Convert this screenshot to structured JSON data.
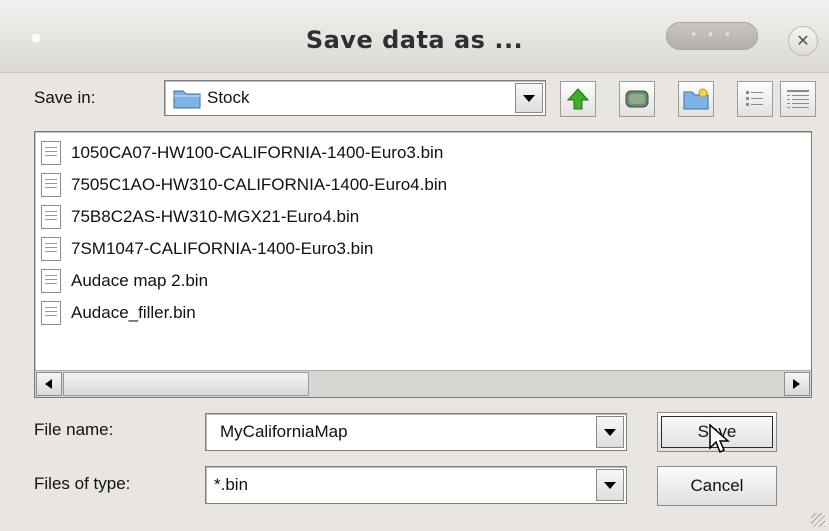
{
  "window": {
    "title": "Save data as ...",
    "title_bar_pill": "• • •",
    "close_glyph": "✕"
  },
  "save_in": {
    "label": "Save in:",
    "folder": "Stock",
    "folder_icon": "folder-icon",
    "toolbar": [
      {
        "name": "up-one-level-button",
        "icon": "green-up-arrow-icon"
      },
      {
        "name": "desktop-button",
        "icon": "desktop-icon"
      },
      {
        "name": "create-new-folder-button",
        "icon": "new-folder-icon"
      },
      {
        "name": "list-view-button",
        "icon": "list-view-icon"
      },
      {
        "name": "details-view-button",
        "icon": "details-view-icon"
      }
    ]
  },
  "files": [
    {
      "name": "1050CA07-HW100-CALIFORNIA-1400-Euro3.bin"
    },
    {
      "name": "7505C1AO-HW310-CALIFORNIA-1400-Euro4.bin"
    },
    {
      "name": "75B8C2AS-HW310-MGX21-Euro4.bin"
    },
    {
      "name": "7SM1047-CALIFORNIA-1400-Euro3.bin"
    },
    {
      "name": "Audace map 2.bin"
    },
    {
      "name": "Audace_filler.bin"
    }
  ],
  "file_name": {
    "label": "File name:",
    "value": "MyCaliforniaMap"
  },
  "file_type": {
    "label": "Files of type:",
    "value": "*.bin"
  },
  "buttons": {
    "save": "Save",
    "cancel": "Cancel"
  },
  "colors": {
    "dialog_bg": "#e9e6e1",
    "up_arrow": "#3fae2a",
    "folder": "#7fb2e6"
  }
}
